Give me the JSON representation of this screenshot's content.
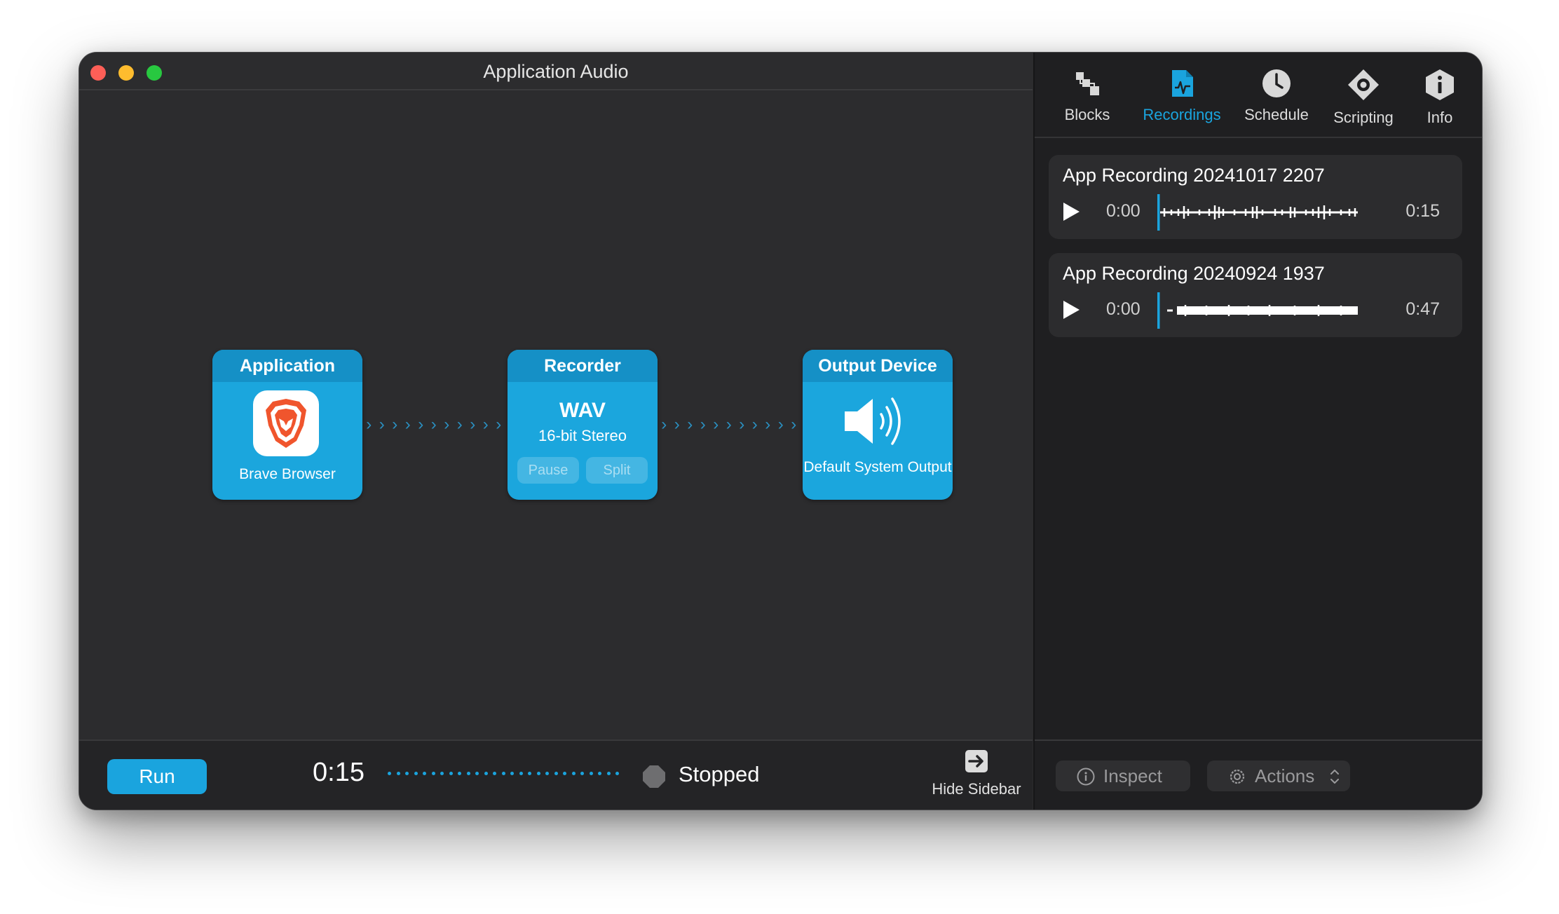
{
  "window": {
    "title": "Application Audio"
  },
  "blocks": {
    "application": {
      "header": "Application",
      "caption": "Brave Browser",
      "icon": "brave-lion-icon"
    },
    "recorder": {
      "header": "Recorder",
      "format": "WAV",
      "format_detail": "16-bit Stereo",
      "pause_label": "Pause",
      "split_label": "Split"
    },
    "output": {
      "header": "Output Device",
      "caption": "Default System Output",
      "icon": "speaker-icon"
    }
  },
  "bottombar": {
    "run_label": "Run",
    "elapsed": "0:15",
    "status": "Stopped",
    "hide_sidebar_label": "Hide Sidebar"
  },
  "sidebar": {
    "tabs": [
      {
        "label": "Blocks",
        "icon": "blocks-icon",
        "active": false
      },
      {
        "label": "Recordings",
        "icon": "recordings-icon",
        "active": true
      },
      {
        "label": "Schedule",
        "icon": "clock-icon",
        "active": false
      },
      {
        "label": "Scripting",
        "icon": "scripting-icon",
        "active": false
      },
      {
        "label": "Info",
        "icon": "info-icon",
        "active": false
      }
    ],
    "recordings": [
      {
        "name": "App Recording 20241017 2207",
        "position": "0:00",
        "duration": "0:15"
      },
      {
        "name": "App Recording 20240924 1937",
        "position": "0:00",
        "duration": "0:47"
      }
    ],
    "inspect_label": "Inspect",
    "actions_label": "Actions"
  },
  "colors": {
    "accent": "#1aa4de",
    "block_header": "#1590c6",
    "close": "#fe5f57",
    "minimize": "#febc2e",
    "maximize": "#28c840"
  }
}
